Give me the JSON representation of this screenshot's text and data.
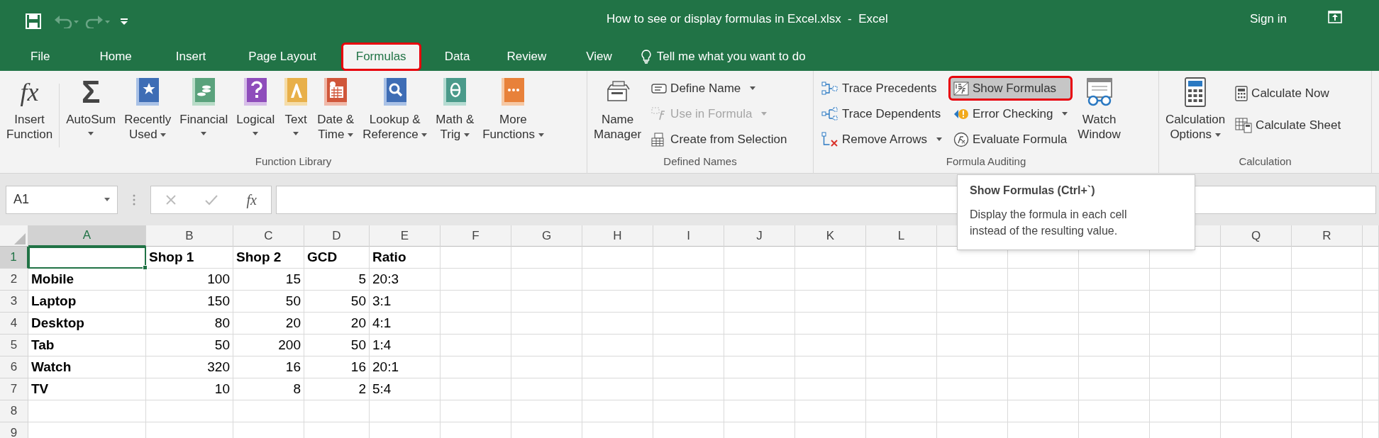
{
  "title_bar": {
    "title": "How to see or display formulas in Excel.xlsx  -  Excel",
    "sign_in": "Sign in"
  },
  "tabs": [
    {
      "label": "File",
      "selected": false,
      "annotated": false
    },
    {
      "label": "Home",
      "selected": false,
      "annotated": false
    },
    {
      "label": "Insert",
      "selected": false,
      "annotated": false
    },
    {
      "label": "Page Layout",
      "selected": false,
      "annotated": false
    },
    {
      "label": "Formulas",
      "selected": true,
      "annotated": true
    },
    {
      "label": "Data",
      "selected": false,
      "annotated": false
    },
    {
      "label": "Review",
      "selected": false,
      "annotated": false
    },
    {
      "label": "View",
      "selected": false,
      "annotated": false
    }
  ],
  "tell_me": "Tell me what you want to do",
  "ribbon_groups": [
    {
      "label": "Function Library",
      "columns": [
        {
          "kind": "large",
          "lines": [
            "Insert",
            "Function"
          ],
          "glyph": "fx",
          "dropdown": false
        },
        {
          "kind": "large",
          "lines": [
            "AutoSum"
          ],
          "glyph": "Σ",
          "dropdown": true
        },
        {
          "kind": "large",
          "lines": [
            "Recently",
            "Used"
          ],
          "dropdown": true
        },
        {
          "kind": "large",
          "lines": [
            "Financial"
          ],
          "dropdown": true
        },
        {
          "kind": "large",
          "lines": [
            "Logical"
          ],
          "dropdown": true
        },
        {
          "kind": "large",
          "lines": [
            "Text"
          ],
          "dropdown": true
        },
        {
          "kind": "large",
          "lines": [
            "Date &",
            "Time"
          ],
          "dropdown": true
        },
        {
          "kind": "large",
          "lines": [
            "Lookup &",
            "Reference"
          ],
          "dropdown": true
        },
        {
          "kind": "large",
          "lines": [
            "Math &",
            "Trig"
          ],
          "dropdown": true
        },
        {
          "kind": "large",
          "lines": [
            "More",
            "Functions"
          ],
          "dropdown": true
        }
      ]
    },
    {
      "label": "Defined Names",
      "columns": [
        {
          "kind": "large",
          "lines": [
            "Name",
            "Manager"
          ],
          "dropdown": false
        },
        {
          "kind": "stack",
          "items": [
            {
              "label": "Define Name",
              "dropdown": true,
              "disabled": false,
              "pressed": false,
              "annotated": false
            },
            {
              "label": "Use in Formula",
              "dropdown": true,
              "disabled": true,
              "pressed": false,
              "annotated": false
            },
            {
              "label": "Create from Selection",
              "dropdown": false,
              "disabled": false,
              "pressed": false,
              "annotated": false
            }
          ]
        }
      ]
    },
    {
      "label": "Formula Auditing",
      "columns": [
        {
          "kind": "stack",
          "items": [
            {
              "label": "Trace Precedents",
              "dropdown": false,
              "disabled": false,
              "pressed": false,
              "annotated": false
            },
            {
              "label": "Trace Dependents",
              "dropdown": false,
              "disabled": false,
              "pressed": false,
              "annotated": false
            },
            {
              "label": "Remove Arrows",
              "dropdown": true,
              "disabled": false,
              "pressed": false,
              "annotated": false
            }
          ]
        },
        {
          "kind": "stack",
          "items": [
            {
              "label": "Show Formulas",
              "dropdown": false,
              "disabled": false,
              "pressed": true,
              "annotated": true
            },
            {
              "label": "Error Checking",
              "dropdown": true,
              "disabled": false,
              "pressed": false,
              "annotated": false
            },
            {
              "label": "Evaluate Formula",
              "dropdown": false,
              "disabled": false,
              "pressed": false,
              "annotated": false
            }
          ]
        },
        {
          "kind": "large",
          "lines": [
            "Watch",
            "Window"
          ],
          "dropdown": false
        }
      ]
    },
    {
      "label": "Calculation",
      "columns": [
        {
          "kind": "large",
          "lines": [
            "Calculation",
            "Options"
          ],
          "dropdown": true
        },
        {
          "kind": "stack",
          "items": [
            {
              "label": "Calculate Now",
              "dropdown": false,
              "disabled": false,
              "pressed": false,
              "annotated": false
            },
            {
              "label": "Calculate Sheet",
              "dropdown": false,
              "disabled": false,
              "pressed": false,
              "annotated": false
            }
          ]
        }
      ]
    }
  ],
  "formula_bar": {
    "name_box": "A1",
    "function_glyph": "fx"
  },
  "column_headers": [
    {
      "label": "A",
      "selected": true
    },
    {
      "label": "B",
      "selected": false
    },
    {
      "label": "C",
      "selected": false
    },
    {
      "label": "D",
      "selected": false
    },
    {
      "label": "E",
      "selected": false
    },
    {
      "label": "F",
      "selected": false
    },
    {
      "label": "G",
      "selected": false
    },
    {
      "label": "H",
      "selected": false
    },
    {
      "label": "I",
      "selected": false
    },
    {
      "label": "J",
      "selected": false
    },
    {
      "label": "K",
      "selected": false
    },
    {
      "label": "L",
      "selected": false
    },
    {
      "label": "Q",
      "selected": false
    },
    {
      "label": "R",
      "selected": false
    }
  ],
  "rows": [
    {
      "label": "1",
      "selected": true,
      "cells": {
        "B": {
          "text": "Shop 1",
          "kind": "text",
          "bold": true
        },
        "C": {
          "text": "Shop 2",
          "kind": "text",
          "bold": true
        },
        "D": {
          "text": "GCD",
          "kind": "text",
          "bold": true
        },
        "E": {
          "text": "Ratio",
          "kind": "text",
          "bold": true
        }
      }
    },
    {
      "label": "2",
      "selected": false,
      "cells": {
        "A": {
          "text": "Mobile",
          "kind": "text",
          "bold": true
        },
        "B": {
          "text": "100",
          "kind": "number",
          "bold": false
        },
        "C": {
          "text": "15",
          "kind": "number",
          "bold": false
        },
        "D": {
          "text": "5",
          "kind": "number",
          "bold": false
        },
        "E": {
          "text": "20:3",
          "kind": "text",
          "bold": false
        }
      }
    },
    {
      "label": "3",
      "selected": false,
      "cells": {
        "A": {
          "text": "Laptop",
          "kind": "text",
          "bold": true
        },
        "B": {
          "text": "150",
          "kind": "number",
          "bold": false
        },
        "C": {
          "text": "50",
          "kind": "number",
          "bold": false
        },
        "D": {
          "text": "50",
          "kind": "number",
          "bold": false
        },
        "E": {
          "text": "3:1",
          "kind": "text",
          "bold": false
        }
      }
    },
    {
      "label": "4",
      "selected": false,
      "cells": {
        "A": {
          "text": "Desktop",
          "kind": "text",
          "bold": true
        },
        "B": {
          "text": "80",
          "kind": "number",
          "bold": false
        },
        "C": {
          "text": "20",
          "kind": "number",
          "bold": false
        },
        "D": {
          "text": "20",
          "kind": "number",
          "bold": false
        },
        "E": {
          "text": "4:1",
          "kind": "text",
          "bold": false
        }
      }
    },
    {
      "label": "5",
      "selected": false,
      "cells": {
        "A": {
          "text": "Tab",
          "kind": "text",
          "bold": true
        },
        "B": {
          "text": "50",
          "kind": "number",
          "bold": false
        },
        "C": {
          "text": "200",
          "kind": "number",
          "bold": false
        },
        "D": {
          "text": "50",
          "kind": "number",
          "bold": false
        },
        "E": {
          "text": "1:4",
          "kind": "text",
          "bold": false
        }
      }
    },
    {
      "label": "6",
      "selected": false,
      "cells": {
        "A": {
          "text": "Watch",
          "kind": "text",
          "bold": true
        },
        "B": {
          "text": "320",
          "kind": "number",
          "bold": false
        },
        "C": {
          "text": "16",
          "kind": "number",
          "bold": false
        },
        "D": {
          "text": "16",
          "kind": "number",
          "bold": false
        },
        "E": {
          "text": "20:1",
          "kind": "text",
          "bold": false
        }
      }
    },
    {
      "label": "7",
      "selected": false,
      "cells": {
        "A": {
          "text": "TV",
          "kind": "text",
          "bold": true
        },
        "B": {
          "text": "10",
          "kind": "number",
          "bold": false
        },
        "C": {
          "text": "8",
          "kind": "number",
          "bold": false
        },
        "D": {
          "text": "2",
          "kind": "number",
          "bold": false
        },
        "E": {
          "text": "5:4",
          "kind": "text",
          "bold": false
        }
      }
    },
    {
      "label": "8",
      "selected": false,
      "cells": {}
    },
    {
      "label": "9",
      "selected": false,
      "cells": {}
    }
  ],
  "tooltip": {
    "title": "Show Formulas (Ctrl+`)",
    "lines": [
      "Display the formula in each cell",
      "instead of the resulting value."
    ]
  }
}
